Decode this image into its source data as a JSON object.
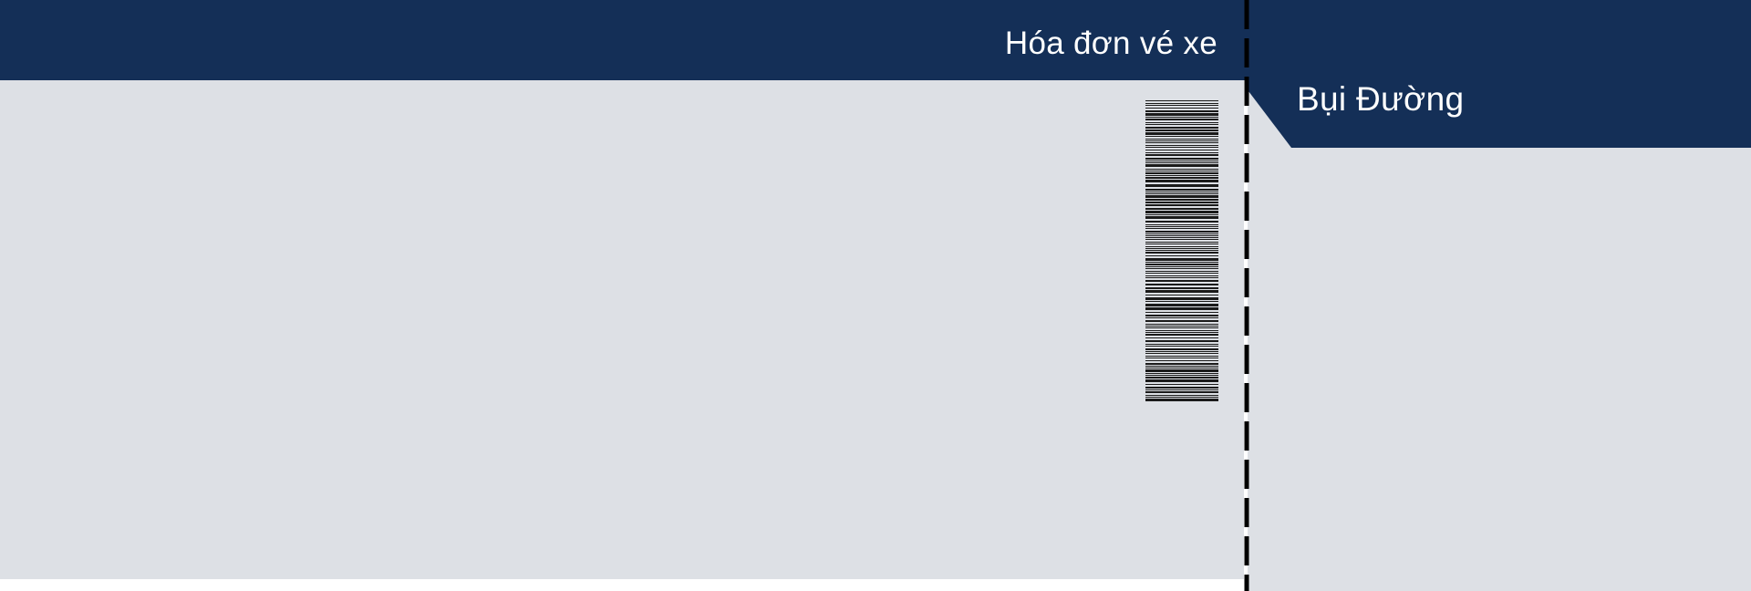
{
  "ticket": {
    "title": "Hóa đơn vé xe",
    "passenger_name": "Bụi Đường"
  },
  "colors": {
    "header_navy": "#142f57",
    "panel_gray": "#dde0e5",
    "perforation": "#000000",
    "barcode": "#1a1a1a"
  },
  "icons": {
    "barcode": "barcode-icon"
  }
}
